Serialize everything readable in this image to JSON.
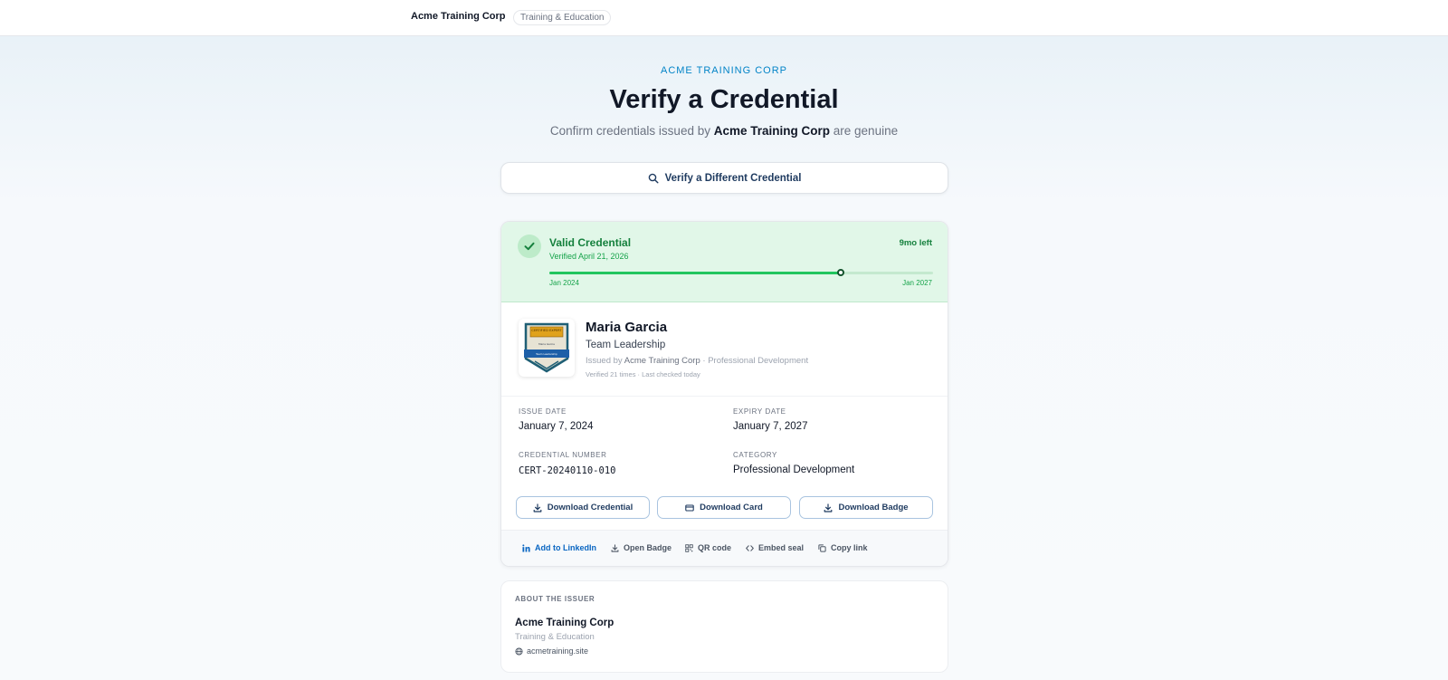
{
  "header": {
    "brand": "Acme Training Corp",
    "pill": "Training & Education"
  },
  "hero": {
    "eyebrow": "ACME TRAINING CORP",
    "title": "Verify a Credential",
    "subtitle_prefix": "Confirm credentials issued by",
    "subtitle_org": "Acme Training Corp",
    "subtitle_suffix": "are genuine"
  },
  "verify_button": {
    "label": "Verify a Different Credential",
    "icon": "search-icon"
  },
  "status": {
    "title": "Valid Credential",
    "verified_on": "Verified April 21, 2026",
    "time_left": "9mo left",
    "progress": 0.76,
    "start_label": "Jan 2024",
    "end_label": "Jan 2027",
    "accent": "#22c55e"
  },
  "holder": {
    "name": "Maria Garcia",
    "course": "Team Leadership",
    "issued_by_prefix": "Issued by",
    "issued_by_org": "Acme Training Corp",
    "issued_by_suffix": "· Professional Development",
    "verified_stats": "Verified 21 times · Last checked today",
    "badge": {
      "top_text": "CERTIFIED EXPERT",
      "name_text": "Maria Garcia",
      "ribbon_text": "Team Leadership"
    }
  },
  "fields": {
    "issue_date_label": "ISSUE DATE",
    "issue_date": "January 7, 2024",
    "expiry_date_label": "EXPIRY DATE",
    "expiry_date": "January 7, 2027",
    "credential_number_label": "CREDENTIAL NUMBER",
    "credential_number": "CERT-20240110-010",
    "category_label": "CATEGORY",
    "category": "Professional Development"
  },
  "actions": {
    "download_credential": "Download Credential",
    "download_card": "Download Card",
    "download_badge": "Download Badge"
  },
  "links": {
    "linkedin": "Add to LinkedIn",
    "open_badge": "Open Badge",
    "qr_code": "QR code",
    "embed_seal": "Embed seal",
    "copy_link": "Copy link"
  },
  "issuer": {
    "section_label": "ABOUT THE ISSUER",
    "name": "Acme Training Corp",
    "category": "Training & Education",
    "website": "acmetraining.site"
  }
}
